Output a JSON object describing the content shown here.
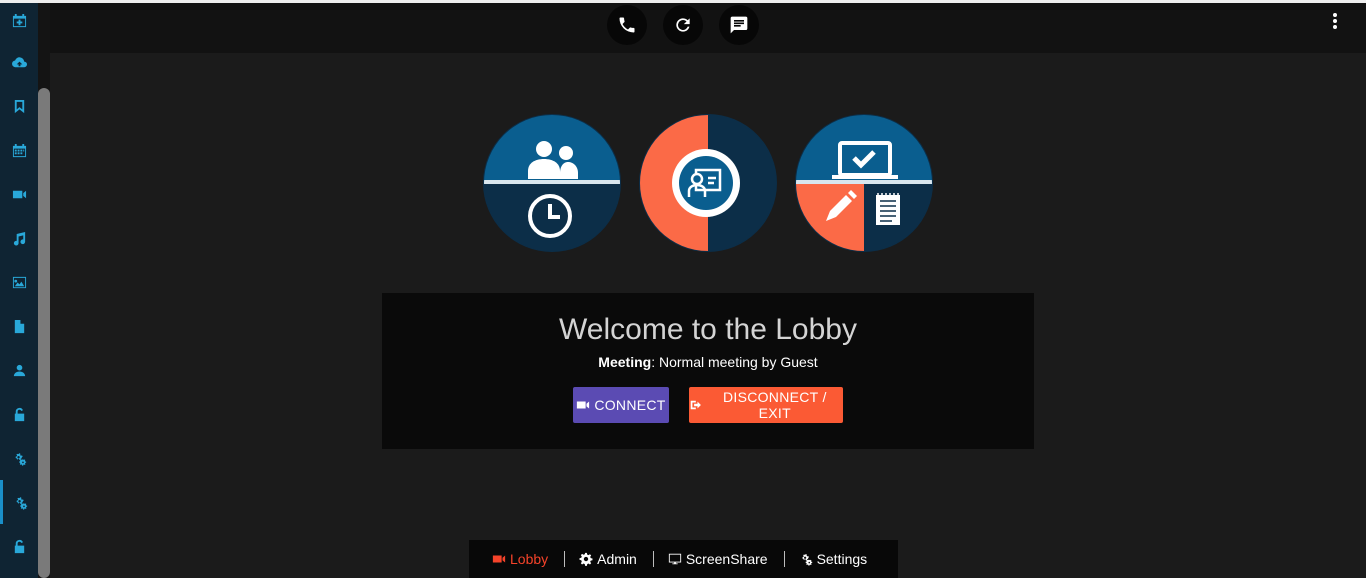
{
  "sidebar": {
    "items": [
      {
        "name": "calendar-plus"
      },
      {
        "name": "cloud-upload"
      },
      {
        "name": "bookmark"
      },
      {
        "name": "calendar"
      },
      {
        "name": "video"
      },
      {
        "name": "music"
      },
      {
        "name": "image"
      },
      {
        "name": "file"
      },
      {
        "name": "user"
      },
      {
        "name": "unlock"
      },
      {
        "name": "cogs"
      },
      {
        "name": "cogs-active"
      },
      {
        "name": "unlock-2"
      }
    ],
    "active_index": 11,
    "accent": "#29a8d9"
  },
  "topbar": {
    "buttons": [
      "phone-icon",
      "refresh-icon",
      "chat-icon"
    ],
    "menu": "more-vert-icon"
  },
  "lobby": {
    "title": "Welcome to the Lobby",
    "meeting_label": "Meeting",
    "meeting_value": ": Normal meeting by Guest",
    "connect_label": "CONNECT",
    "exit_label": "DISCONNECT / EXIT",
    "connect_color": "#5b4bb3",
    "exit_color": "#fb5a34"
  },
  "tabs": [
    {
      "label": "Lobby",
      "icon": "video-icon",
      "active": true
    },
    {
      "label": "Admin",
      "icon": "gear-icon",
      "active": false
    },
    {
      "label": "ScreenShare",
      "icon": "monitor-icon",
      "active": false
    },
    {
      "label": "Settings",
      "icon": "cogs-icon",
      "active": false
    }
  ],
  "colors": {
    "background": "#1b1b1b",
    "badge_navy": "#0f3a5a",
    "badge_blue": "#0a5e8f",
    "badge_orange": "#fb6a47",
    "active_tab": "#f5432a"
  }
}
